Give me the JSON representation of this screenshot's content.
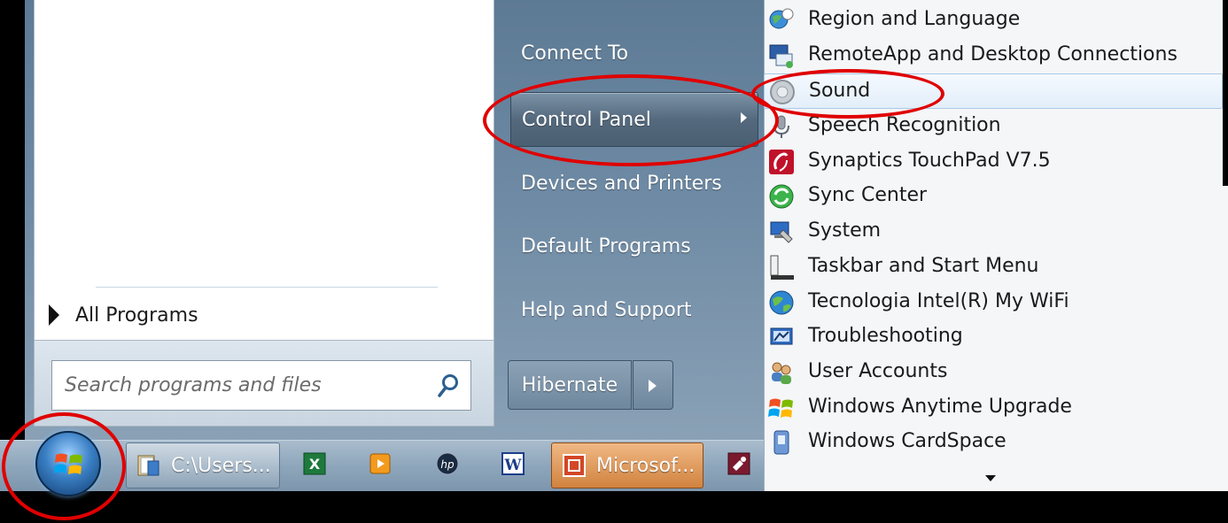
{
  "start_menu": {
    "all_programs_label": "All Programs",
    "search_placeholder": "Search programs and files",
    "right_column": [
      {
        "label": "Connect To",
        "has_submenu": false
      },
      {
        "label": "Control Panel",
        "has_submenu": true,
        "active": true
      },
      {
        "label": "Devices and Printers",
        "has_submenu": false
      },
      {
        "label": "Default Programs",
        "has_submenu": false
      },
      {
        "label": "Help and Support",
        "has_submenu": false
      }
    ],
    "shutdown_label": "Hibernate"
  },
  "taskbar": {
    "buttons": [
      {
        "label": "C:\\Users...",
        "icon": "folder-icon"
      },
      {
        "label": "Microsof...",
        "icon": "powerpoint-icon",
        "active": true
      }
    ],
    "pinned_icons": [
      "excel-icon",
      "media-player-icon",
      "hp-icon",
      "word-icon",
      "access-icon"
    ]
  },
  "control_panel_submenu": {
    "items": [
      {
        "label": "Region and Language",
        "icon": "globe-clock-icon"
      },
      {
        "label": "RemoteApp and Desktop Connections",
        "icon": "remote-desktop-icon"
      },
      {
        "label": "Sound",
        "icon": "speaker-icon",
        "hovered": true
      },
      {
        "label": "Speech Recognition",
        "icon": "microphone-icon"
      },
      {
        "label": "Synaptics TouchPad V7.5",
        "icon": "synaptics-icon"
      },
      {
        "label": "Sync Center",
        "icon": "sync-icon"
      },
      {
        "label": "System",
        "icon": "computer-icon"
      },
      {
        "label": "Taskbar and Start Menu",
        "icon": "taskbar-icon"
      },
      {
        "label": "Tecnologia Intel(R) My WiFi",
        "icon": "wifi-globe-icon"
      },
      {
        "label": "Troubleshooting",
        "icon": "troubleshoot-icon"
      },
      {
        "label": "User Accounts",
        "icon": "users-icon"
      },
      {
        "label": "Windows Anytime Upgrade",
        "icon": "windows-flag-icon"
      },
      {
        "label": "Windows CardSpace",
        "icon": "cardspace-icon"
      }
    ]
  },
  "colors": {
    "annotation": "#e00000",
    "start_menu_blue": "#6e8aa4",
    "active_taskbar": "#d1833f"
  }
}
